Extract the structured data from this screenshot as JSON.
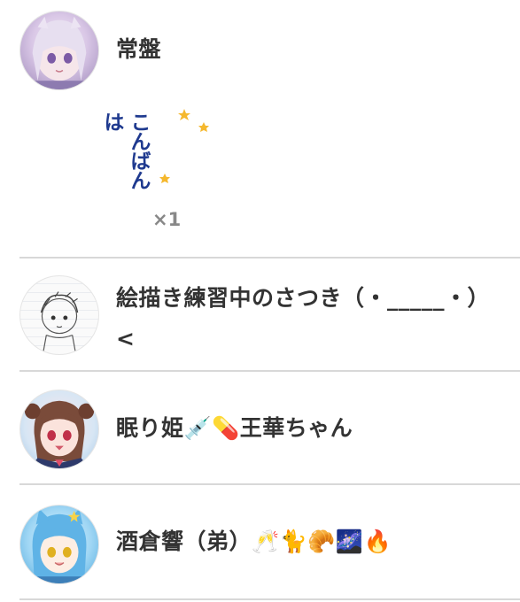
{
  "users": [
    {
      "name": "常盤",
      "avatar": "avatar-anime-silver-hair"
    },
    {
      "name": "絵描き練習中のさつき（・_____・）<",
      "avatar": "avatar-pencil-sketch"
    },
    {
      "name": "眠り姫💉💊王華ちゃん",
      "avatar": "avatar-brown-hair-girl"
    },
    {
      "name": "酒倉響（弟）🥂🐈🥐🌌🔥",
      "avatar": "avatar-blue-hair-catgirl"
    }
  ],
  "stamp": {
    "text": "こんばんは",
    "icon": "crescent-moon-stars-icon",
    "count": "×1"
  },
  "colors": {
    "name_text": "#333333",
    "divider": "#d8d8d8",
    "stamp_text": "#1f3a8f",
    "moon": "#f5b82e"
  }
}
